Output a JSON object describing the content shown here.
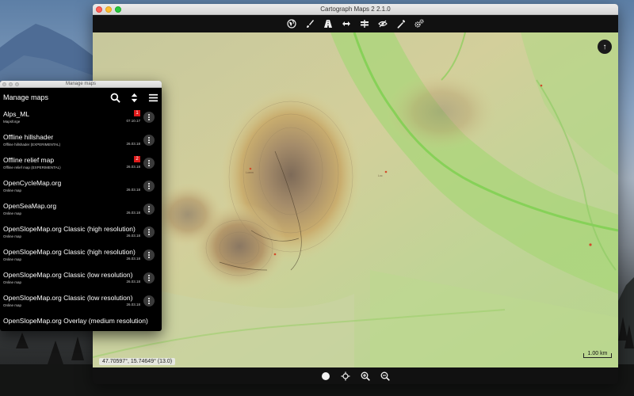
{
  "main_window": {
    "title": "Cartograph Maps 2 2.1.0",
    "toolbar": [
      {
        "name": "globe-icon"
      },
      {
        "name": "brush-icon"
      },
      {
        "name": "road-icon"
      },
      {
        "name": "measure-icon"
      },
      {
        "name": "signpost-icon"
      },
      {
        "name": "eye-slash-icon"
      },
      {
        "name": "wrench-icon"
      },
      {
        "name": "settings-gears-icon"
      }
    ],
    "north_button": "↑",
    "coordinates": "47.70597°, 15.74649° (13.0)",
    "scale_label": "1.00 km",
    "bottom_toolbar": [
      {
        "name": "record-icon"
      },
      {
        "name": "locate-icon"
      },
      {
        "name": "zoom-in-icon"
      },
      {
        "name": "zoom-out-icon"
      }
    ]
  },
  "manage_window": {
    "window_title": "Manage maps",
    "header_title": "Manage maps",
    "items": [
      {
        "name": "Alps_ML",
        "sub": "Mapsforge",
        "date": "07.10.17",
        "badge": "1"
      },
      {
        "name": "Offline hillshader",
        "sub": "Offline hillshader (EXPERIMENTAL)",
        "date": "26.03.18",
        "badge": ""
      },
      {
        "name": "Offline relief map",
        "sub": "Offline relief map (EXPERIMENTAL)",
        "date": "26.03.18",
        "badge": "2"
      },
      {
        "name": "OpenCycleMap.org",
        "sub": "Online map",
        "date": "26.03.18",
        "badge": ""
      },
      {
        "name": "OpenSeaMap.org",
        "sub": "Online map",
        "date": "26.03.18",
        "badge": ""
      },
      {
        "name": "OpenSlopeMap.org Classic (high resolution)",
        "sub": "Online map",
        "date": "26.03.18",
        "badge": ""
      },
      {
        "name": "OpenSlopeMap.org Classic (high resolution)",
        "sub": "Online map",
        "date": "26.03.18",
        "badge": ""
      },
      {
        "name": "OpenSlopeMap.org Classic (low resolution)",
        "sub": "Online map",
        "date": "26.03.18",
        "badge": ""
      },
      {
        "name": "OpenSlopeMap.org Classic (low resolution)",
        "sub": "Online map",
        "date": "26.03.18",
        "badge": ""
      },
      {
        "name": "OpenSlopeMap.org Overlay (medium resolution)",
        "sub": "",
        "date": "",
        "badge": ""
      }
    ]
  },
  "colors": {
    "badge": "#e01b1b",
    "map_green": "#a9d57a",
    "map_tan": "#c9a86b"
  }
}
